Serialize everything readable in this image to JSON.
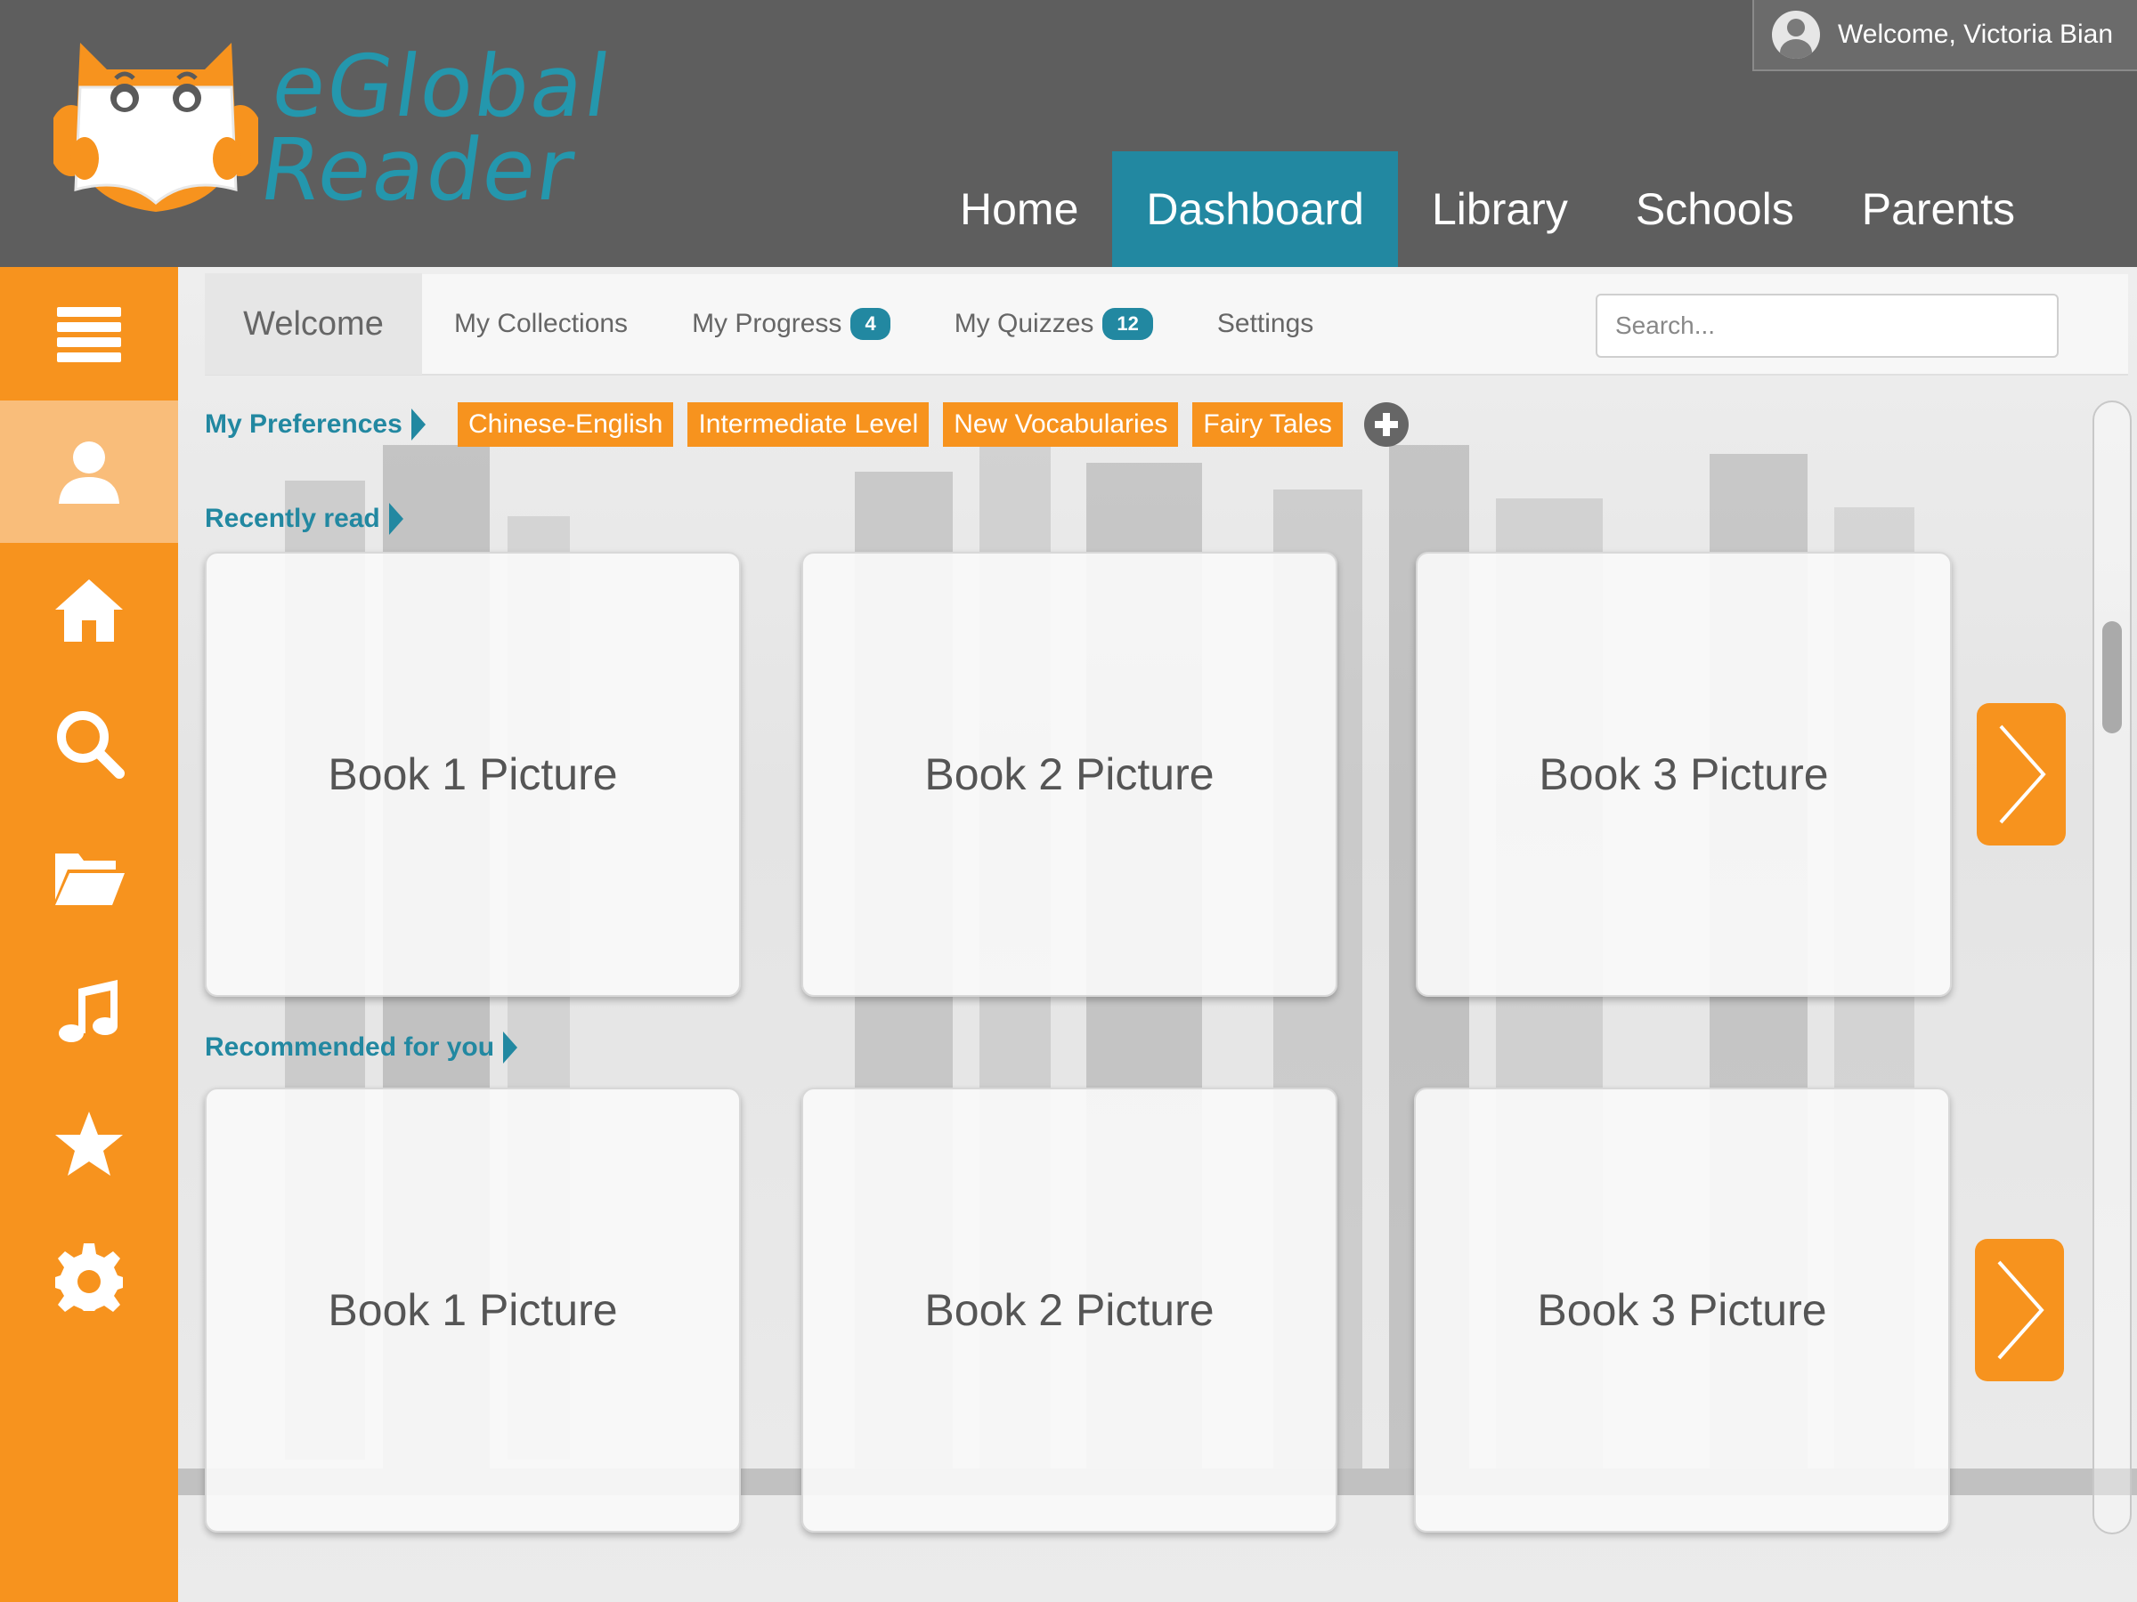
{
  "brand": {
    "line1": "eGlobal",
    "line2": "Reader",
    "colors": {
      "orange": "#f7931e",
      "teal": "#2288a1",
      "header_gray": "#5e5e5e"
    }
  },
  "user": {
    "welcome": "Welcome, Victoria Bian",
    "icon": "user-avatar-icon"
  },
  "main_nav": {
    "items": [
      {
        "label": "Home",
        "active": false
      },
      {
        "label": "Dashboard",
        "active": true
      },
      {
        "label": "Library",
        "active": false
      },
      {
        "label": "Schools",
        "active": false
      },
      {
        "label": "Parents",
        "active": false
      }
    ]
  },
  "sidebar": {
    "items": [
      {
        "icon": "menu-icon",
        "active": false
      },
      {
        "icon": "user-icon",
        "active": true
      },
      {
        "icon": "home-icon",
        "active": false
      },
      {
        "icon": "search-icon",
        "active": false
      },
      {
        "icon": "folder-icon",
        "active": false
      },
      {
        "icon": "music-icon",
        "active": false
      },
      {
        "icon": "star-icon",
        "active": false
      },
      {
        "icon": "gear-icon",
        "active": false
      }
    ]
  },
  "tabs": {
    "welcome": "Welcome",
    "collections": "My Collections",
    "progress": "My Progress",
    "progress_badge": "4",
    "quizzes": "My Quizzes",
    "quizzes_badge": "12",
    "settings": "Settings"
  },
  "search": {
    "placeholder": "Search..."
  },
  "preferences": {
    "label": "My Preferences",
    "chips": [
      "Chinese-English",
      "Intermediate Level",
      "New Vocabularies",
      "Fairy Tales"
    ]
  },
  "recently_read": {
    "label": "Recently read",
    "books": [
      "Book 1 Picture",
      "Book 2 Picture",
      "Book 3 Picture"
    ]
  },
  "recommended": {
    "label": "Recommended for you",
    "books": [
      "Book 1 Picture",
      "Book 2 Picture",
      "Book 3 Picture"
    ]
  }
}
